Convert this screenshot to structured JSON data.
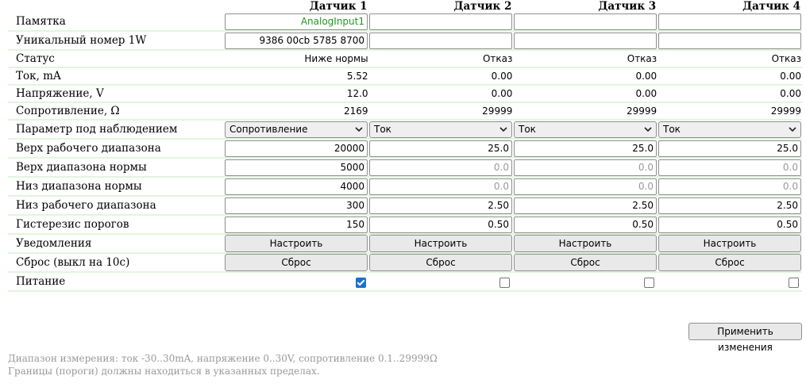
{
  "headers": [
    "Датчик 1",
    "Датчик 2",
    "Датчик 3",
    "Датчик 4"
  ],
  "labels": {
    "memo": "Памятка",
    "uid": "Уникальный номер 1W",
    "status": "Статус",
    "current": "Ток, mA",
    "voltage": "Напряжение, V",
    "resistance": "Сопротивление, Ω",
    "param": "Параметр под наблюдением",
    "top_work": "Верх рабочего диапазона",
    "top_norm": "Верх диапазона нормы",
    "low_norm": "Низ диапазона нормы",
    "low_work": "Низ рабочего диапазона",
    "hyst": "Гистерезис порогов",
    "notif": "Уведомления",
    "reset": "Сброс (выкл на 10с)",
    "power": "Питание"
  },
  "sensors": [
    {
      "memo": "AnalogInput1",
      "uid": "9386 00cb 5785 8700",
      "status": "Ниже нормы",
      "current": "5.52",
      "voltage": "12.0",
      "resistance": "2169",
      "param": "Сопротивление",
      "top_work": "20000",
      "top_norm": "5000",
      "low_norm": "4000",
      "low_work": "300",
      "hyst": "150",
      "power": true
    },
    {
      "memo": "",
      "uid": "",
      "status": "Отказ",
      "current": "0.00",
      "voltage": "0.00",
      "resistance": "29999",
      "param": "Ток",
      "top_work": "25.0",
      "top_norm_placeholder": "0.0",
      "low_norm_placeholder": "0.0",
      "low_work": "2.50",
      "hyst": "0.50",
      "power": false
    },
    {
      "memo": "",
      "uid": "",
      "status": "Отказ",
      "current": "0.00",
      "voltage": "0.00",
      "resistance": "29999",
      "param": "Ток",
      "top_work": "25.0",
      "top_norm_placeholder": "0.0",
      "low_norm_placeholder": "0.0",
      "low_work": "2.50",
      "hyst": "0.50",
      "power": false
    },
    {
      "memo": "",
      "uid": "",
      "status": "Отказ",
      "current": "0.00",
      "voltage": "0.00",
      "resistance": "29999",
      "param": "Ток",
      "top_work": "25.0",
      "top_norm_placeholder": "0.0",
      "low_norm_placeholder": "0.0",
      "low_work": "2.50",
      "hyst": "0.50",
      "power": false
    }
  ],
  "buttons": {
    "configure": "Настроить",
    "reset": "Сброс",
    "apply": "Применить изменения"
  },
  "notes": [
    "Диапазон измерения: ток -30..30mA, напряжение 0..30V, сопротивление 0.1..29999Ω",
    "Границы (пороги) должны находиться в указанных пределах."
  ],
  "colors": {
    "memo_text": "#1e9a1e",
    "row_divider": "#e3f4df",
    "checkbox_on": "#1a6fd0"
  },
  "icons": {
    "select_arrow": "chevron-down-icon",
    "power_checkbox": "checkbox-icon"
  }
}
